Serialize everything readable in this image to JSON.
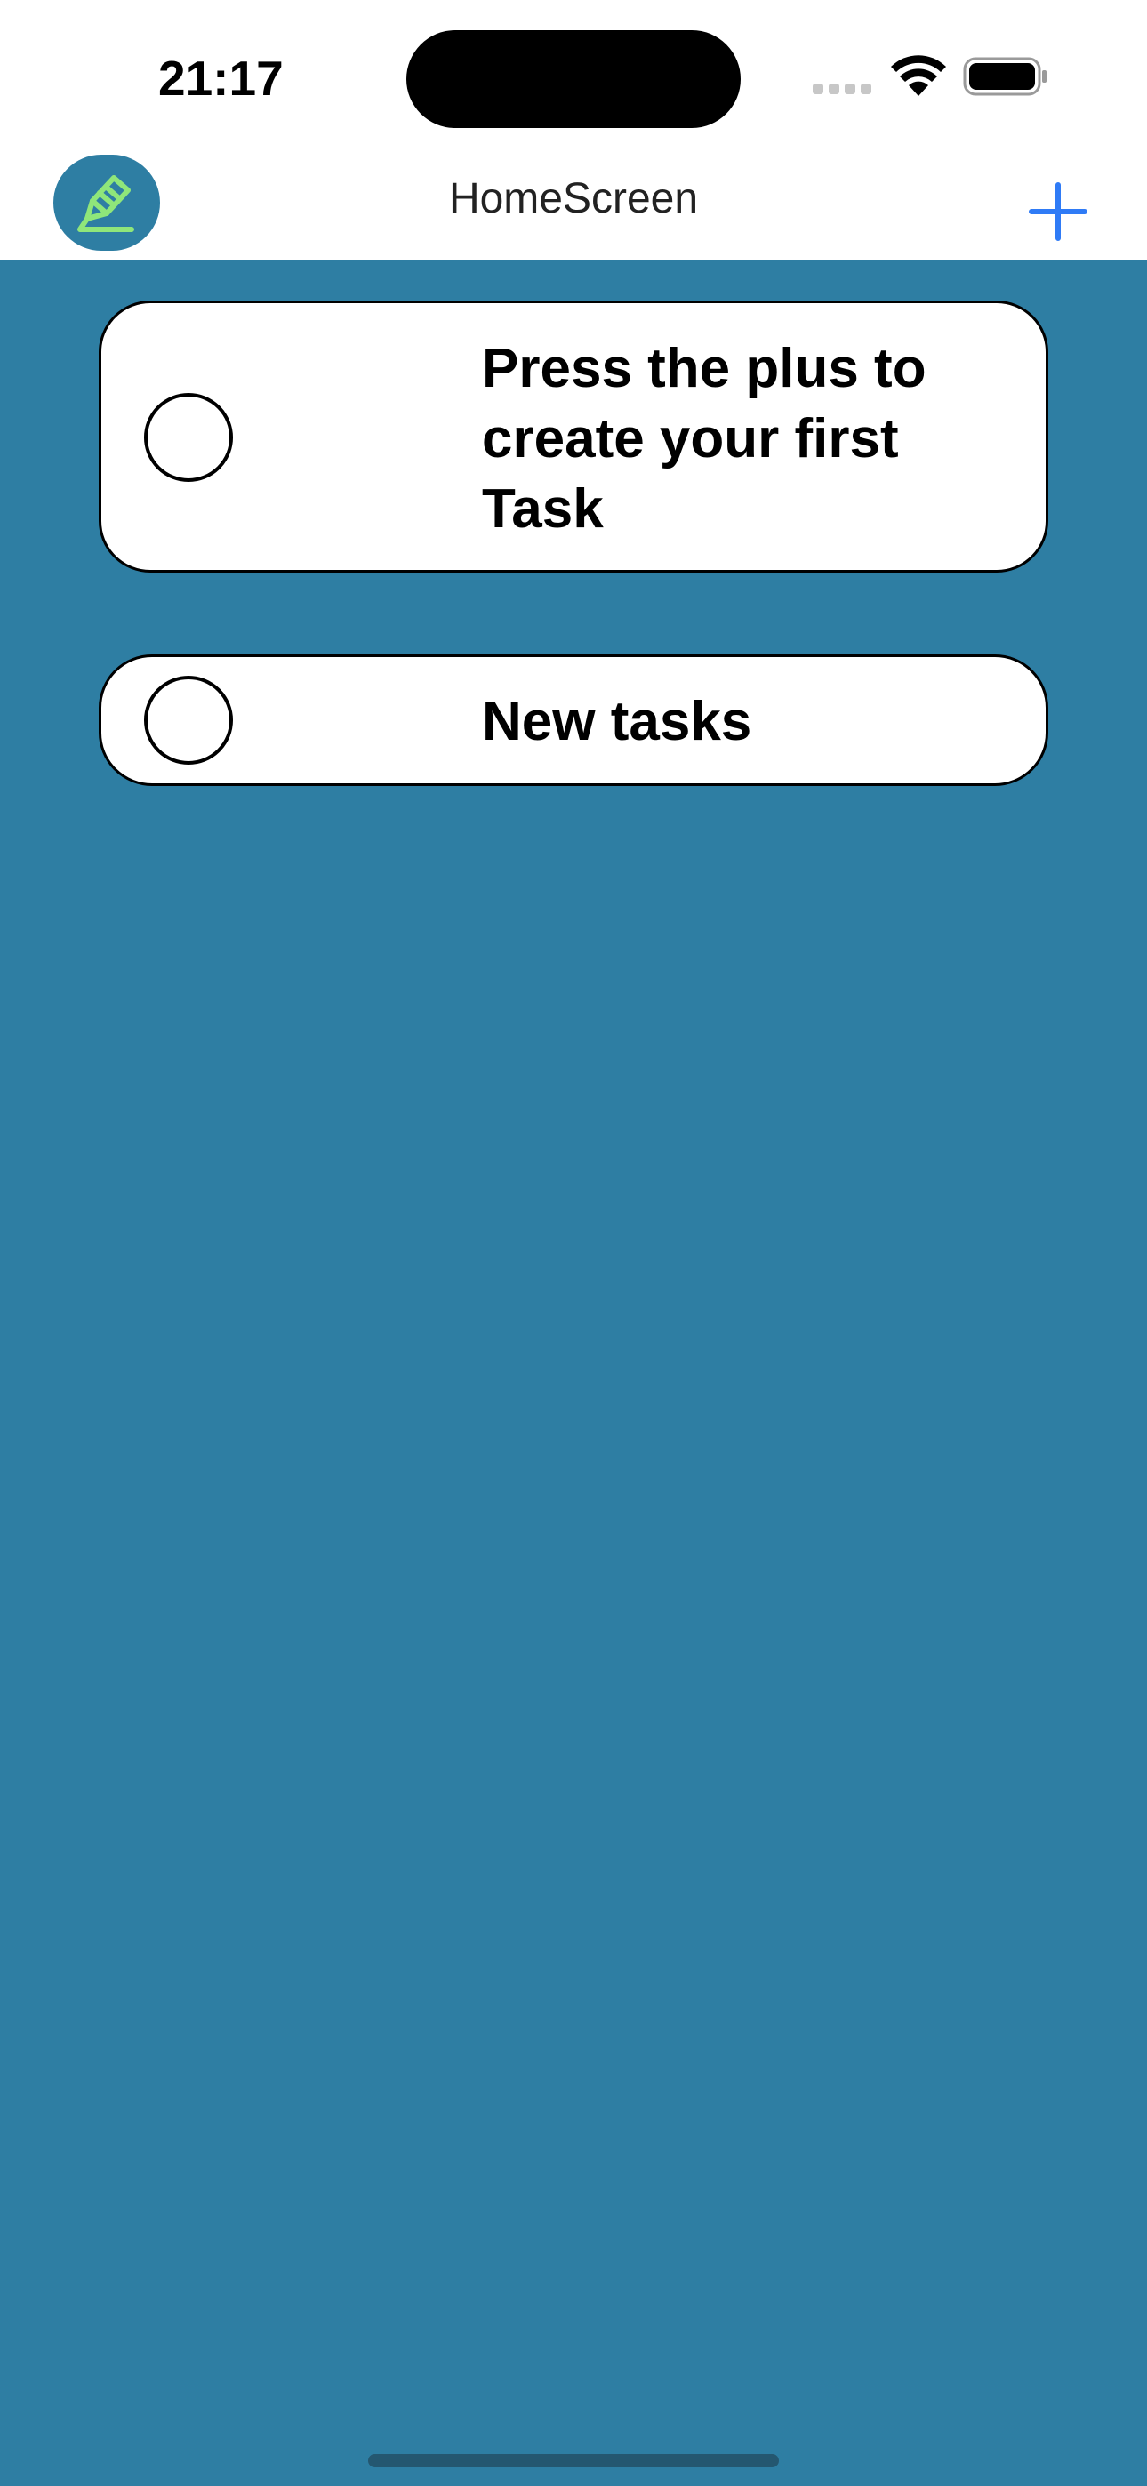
{
  "status_bar": {
    "time": "21:17"
  },
  "nav": {
    "title": "HomeScreen",
    "add_icon": "plus-icon",
    "logo_icon": "pencil-edit-icon"
  },
  "tasks": [
    {
      "label": "Press the plus to create your first Task",
      "checked": false
    },
    {
      "label": "New tasks",
      "checked": false
    }
  ],
  "colors": {
    "background": "#2e7ea3",
    "accent": "#2f7bf6",
    "logo_green": "#8fe67a"
  }
}
